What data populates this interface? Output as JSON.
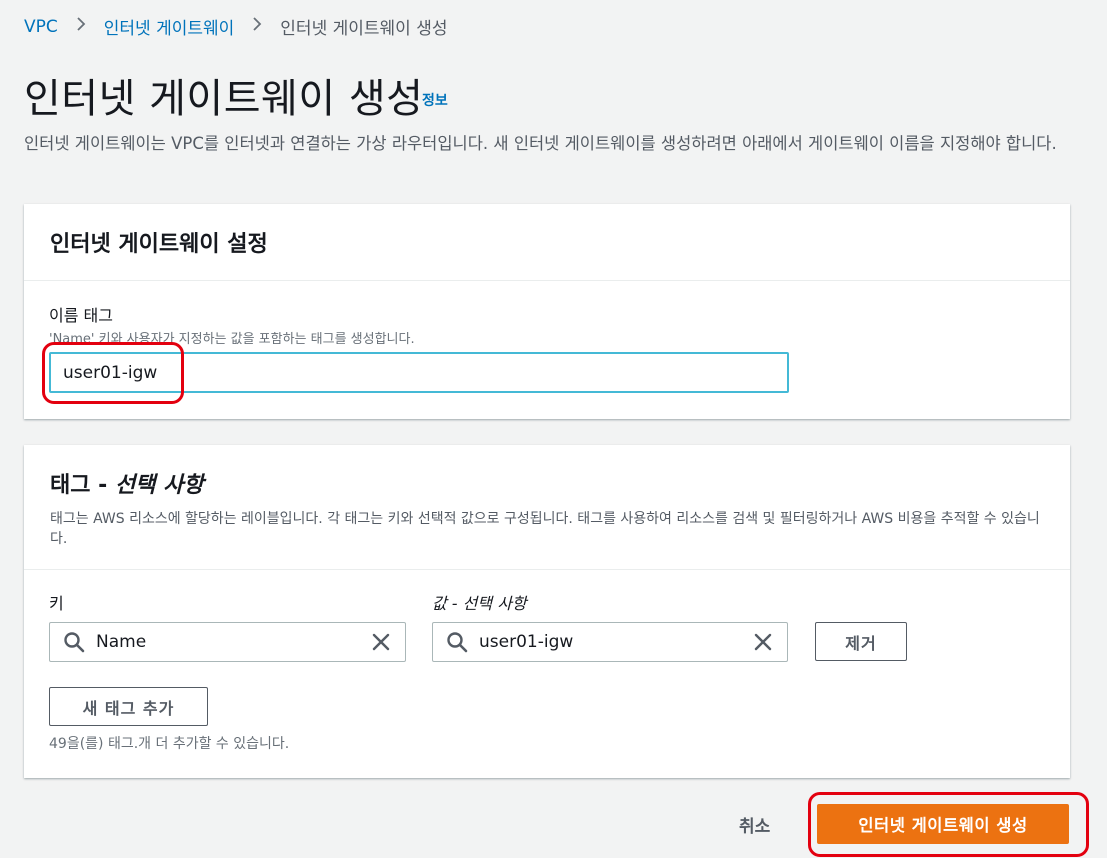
{
  "breadcrumb": {
    "items": [
      "VPC",
      "인터넷 게이트웨이",
      "인터넷 게이트웨이 생성"
    ]
  },
  "page": {
    "title": "인터넷 게이트웨이 생성",
    "info": "정보",
    "description": "인터넷 게이트웨이는 VPC를 인터넷과 연결하는 가상 라우터입니다. 새 인터넷 게이트웨이를 생성하려면 아래에서 게이트웨이 이름을 지정해야 합니다."
  },
  "settings": {
    "title": "인터넷 게이트웨이 설정",
    "name_tag_label": "이름 태그",
    "name_tag_desc": "'Name' 키와 사용자가 지정하는 값을 포함하는 태그를 생성합니다.",
    "name_tag_value": "user01-igw"
  },
  "tags": {
    "title_prefix": "태그 - ",
    "title_optional": "선택 사항",
    "description": "태그는 AWS 리소스에 할당하는 레이블입니다. 각 태그는 키와 선택적 값으로 구성됩니다. 태그를 사용하여 리소스를 검색 및 필터링하거나 AWS 비용을 추적할 수 있습니다.",
    "key_label": "키",
    "value_label": "값 - 선택 사항",
    "key_value": "Name",
    "value_value": "user01-igw",
    "remove_label": "제거",
    "add_label": "새 태그 추가",
    "remaining_note": "49을(를) 태그.개 더 추가할 수 있습니다."
  },
  "footer": {
    "cancel_label": "취소",
    "create_label": "인터넷 게이트웨이 생성"
  },
  "colors": {
    "link": "#0073bb",
    "primary": "#ec7211",
    "highlight": "#e3000f",
    "focus": "#44b9d6"
  },
  "icons": [
    "search-icon",
    "clear-icon",
    "chevron-right-icon"
  ]
}
